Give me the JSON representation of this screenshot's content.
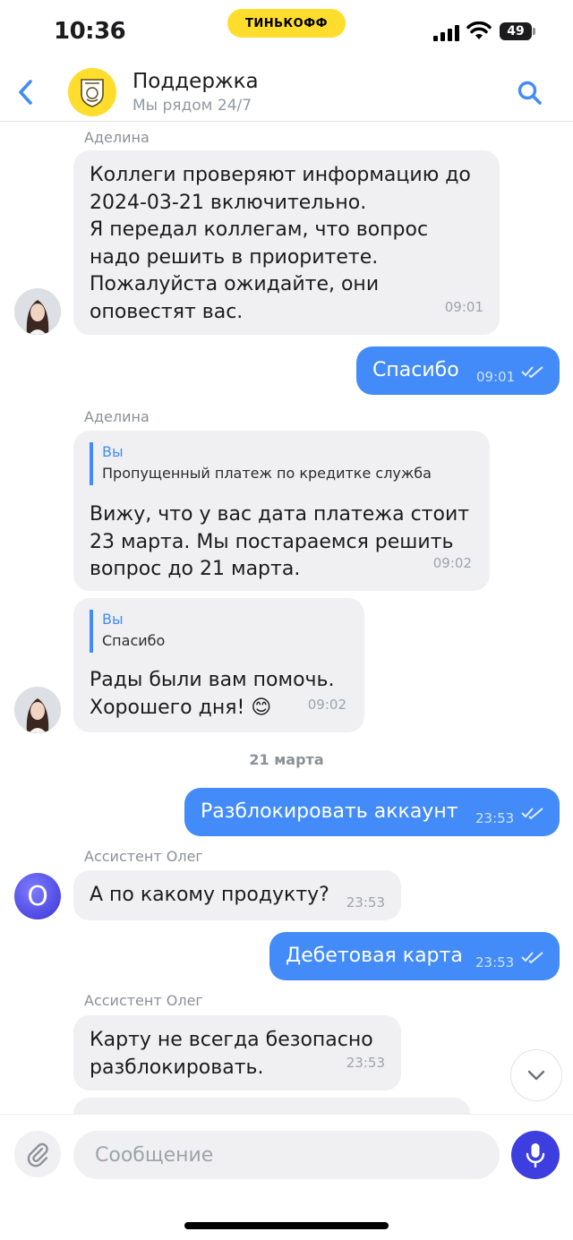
{
  "status_bar": {
    "time": "10:36",
    "brand_pill": "ТИНЬКОФФ",
    "battery": "49"
  },
  "header": {
    "title": "Поддержка",
    "subtitle": "Мы рядом 24/7"
  },
  "messages": [
    {
      "sender": "Аделина",
      "text": "Коллеги проверяют информацию до\n2024-03-21 включительно.\nЯ передал коллегам, что вопрос\nнадо решить в приоритете.\nПожалуйста ожидайте, они\nоповестят вас.",
      "time": "09:01"
    },
    {
      "text": "Спасибо",
      "time": "09:01"
    },
    {
      "sender": "Аделина",
      "quote_name": "Вы",
      "quote_text": "Пропущенный платеж по кредитке служба",
      "text": "Вижу, что у вас дата платежа стоит\n23 марта. Мы постараемся решить\nвопрос до 21 марта.",
      "time": "09:02"
    },
    {
      "quote_name": "Вы",
      "quote_text": "Спасибо",
      "text": "Рады были вам помочь.\nХорошего дня! 😊",
      "time": "09:02"
    },
    {
      "text": "Разблокировать аккаунт",
      "time": "23:53"
    },
    {
      "sender": "Ассистент Олег",
      "avatar_letter": "O",
      "text": "А по какому продукту?",
      "time": "23:53"
    },
    {
      "text": "Дебетовая карта",
      "time": "23:53"
    },
    {
      "sender": "Ассистент Олег",
      "text": "Карту не всегда безопасно\nразблокировать.",
      "time": "23:53"
    }
  ],
  "date_separator": "21 марта",
  "composer": {
    "placeholder": "Сообщение"
  },
  "colors": {
    "accent": "#428bf9",
    "brand": "#ffdd2d",
    "mic": "#3d3ee0"
  },
  "icons": [
    "back-arrow-icon",
    "bank-logo-icon",
    "search-icon",
    "double-check-icon",
    "chevron-down-icon",
    "paperclip-icon",
    "microphone-icon"
  ]
}
